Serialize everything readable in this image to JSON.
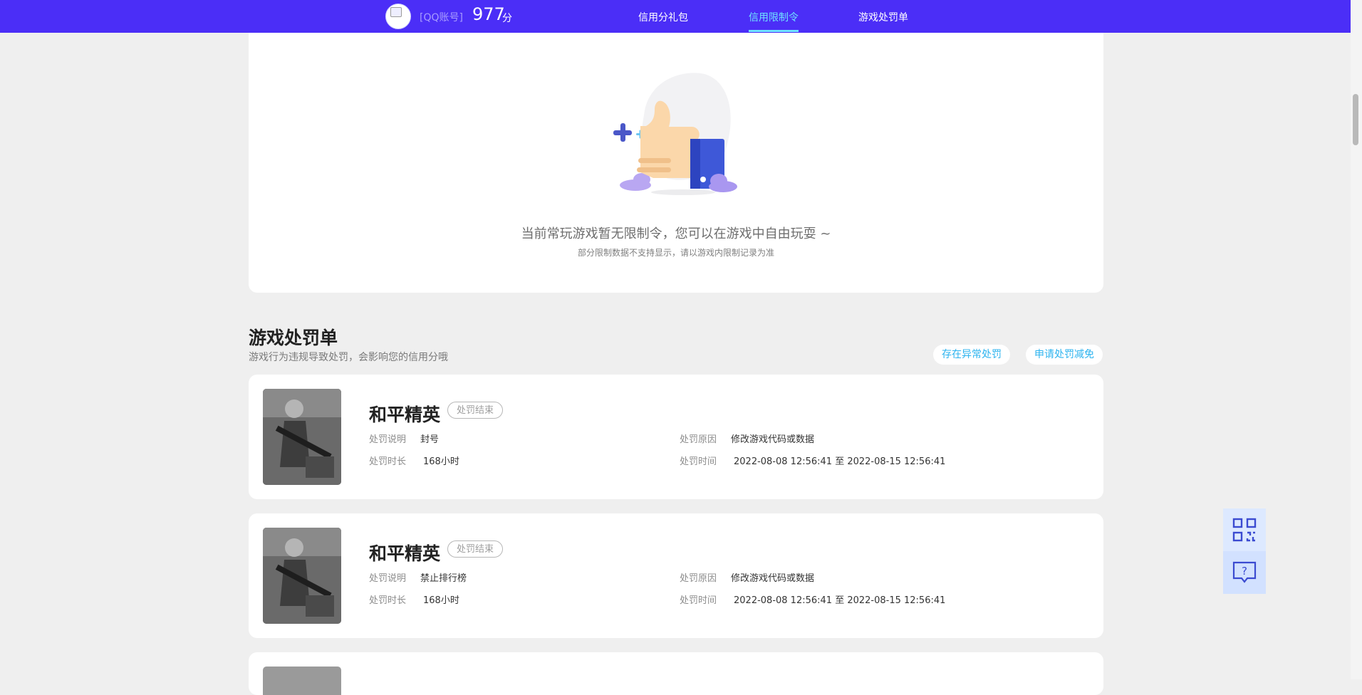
{
  "header": {
    "account_label": "[QQ账号]",
    "score": "977",
    "score_unit": "分",
    "nav": [
      "信用分礼包",
      "信用限制令",
      "游戏处罚单"
    ],
    "active_nav": "信用限制令"
  },
  "empty_state": {
    "title": "当前常玩游戏暂无限制令，您可以在游戏中自由玩耍 ~",
    "subtitle": "部分限制数据不支持显示，请以游戏内限制记录为准"
  },
  "penalty_section": {
    "title": "游戏处罚单",
    "subtitle": "游戏行为违规导致处罚，会影响您的信用分哦",
    "buttons": [
      "存在异常处罚",
      "申请处罚减免"
    ],
    "labels": {
      "desc": "处罚说明",
      "duration": "处罚时长",
      "reason": "处罚原因",
      "time": "处罚时间"
    },
    "items": [
      {
        "game": "和平精英",
        "status": "处罚结束",
        "desc": "封号",
        "duration": "168小时",
        "reason": "修改游戏代码或数据",
        "time": "2022-08-08 12:56:41 至 2022-08-15 12:56:41"
      },
      {
        "game": "和平精英",
        "status": "处罚结束",
        "desc": "禁止排行榜",
        "duration": "168小时",
        "reason": "修改游戏代码或数据",
        "time": "2022-08-08 12:56:41 至 2022-08-15 12:56:41"
      }
    ]
  },
  "colors": {
    "header_bg": "#4b2ef7",
    "accent": "#6fe3ff",
    "link": "#2bb3ef",
    "page_bg": "#efefef"
  },
  "icons": [
    "qr-code-icon",
    "help-chat-icon",
    "thumbs-up-illustration",
    "game-cover-image"
  ]
}
